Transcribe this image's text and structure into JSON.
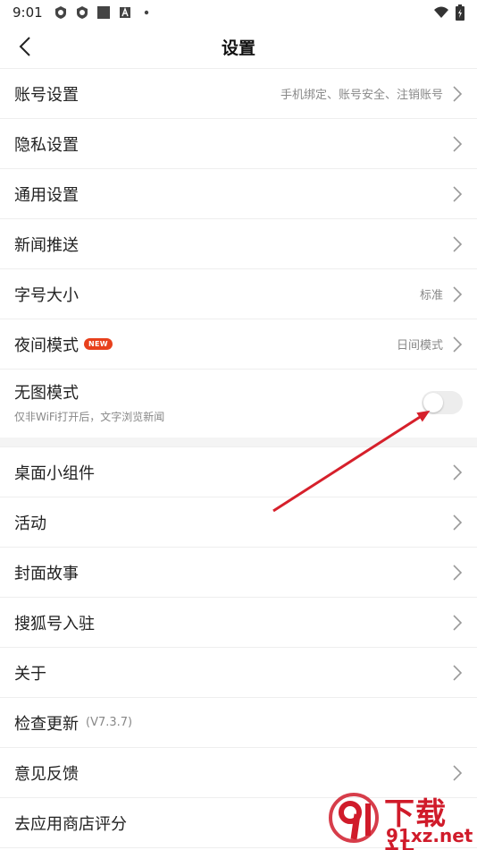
{
  "status_bar": {
    "time": "9:01",
    "left_icons": [
      "shield-icon",
      "shield-icon",
      "square-icon",
      "a-icon",
      "dot-icon"
    ],
    "right_icons": [
      "wifi-icon",
      "battery-icon"
    ]
  },
  "header": {
    "title": "设置",
    "back_icon": "back-chevron-icon"
  },
  "group1": [
    {
      "label": "账号设置",
      "value": "手机绑定、账号安全、注销账号"
    },
    {
      "label": "隐私设置",
      "value": ""
    },
    {
      "label": "通用设置",
      "value": ""
    },
    {
      "label": "新闻推送",
      "value": ""
    },
    {
      "label": "字号大小",
      "value": "标准"
    },
    {
      "label": "夜间模式",
      "badge": "NEW",
      "value": "日间模式"
    }
  ],
  "no_image_mode": {
    "label": "无图模式",
    "subtitle": "仅非WiFi打开后，文字浏览新闻",
    "enabled": false
  },
  "group2": [
    {
      "label": "桌面小组件"
    },
    {
      "label": "活动"
    },
    {
      "label": "封面故事"
    },
    {
      "label": "搜狐号入驻"
    },
    {
      "label": "关于"
    },
    {
      "label": "检查更新",
      "version": "(V7.3.7)"
    },
    {
      "label": "意见反馈"
    },
    {
      "label": "去应用商店评分"
    }
  ],
  "watermark": {
    "cn": "下载站",
    "en": "91xz.net"
  },
  "colors": {
    "accent_red": "#e8401c",
    "arrow_red": "#d6202b",
    "watermark_red": "#d01b2a",
    "divider": "#eeeeee",
    "secondary_text": "#888888"
  }
}
